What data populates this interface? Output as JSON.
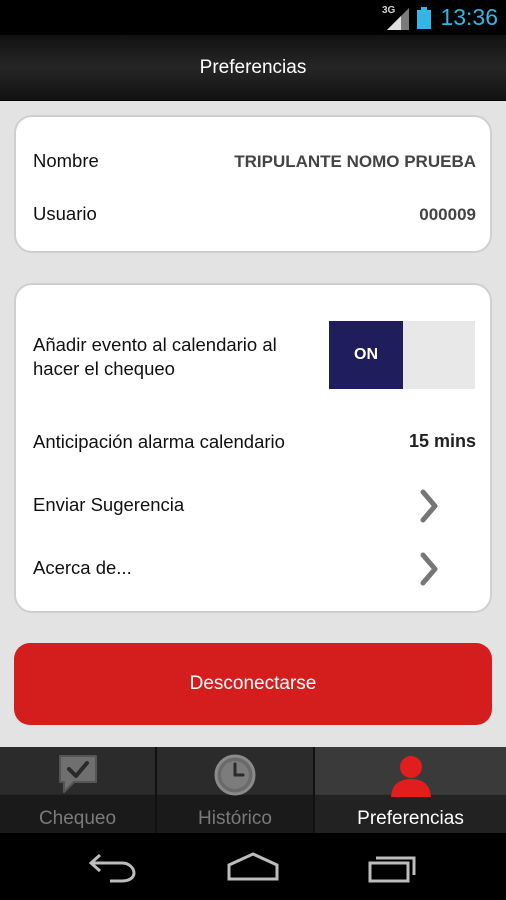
{
  "status_bar": {
    "network": "3G",
    "time": "13:36",
    "accent_color": "#33b5e5"
  },
  "action_bar": {
    "title": "Preferencias"
  },
  "user_card": {
    "nombre_label": "Nombre",
    "nombre_value": "TRIPULANTE NOMO PRUEBA",
    "usuario_label": "Usuario",
    "usuario_value": "000009"
  },
  "settings": {
    "calendar_label": "Añadir evento al calendario al hacer el chequeo",
    "calendar_toggle": "ON",
    "alarm_label": "Anticipación alarma calendario",
    "alarm_value": "15 mins",
    "suggestion_label": "Enviar Sugerencia",
    "about_label": "Acerca de..."
  },
  "logout": {
    "label": "Desconectarse",
    "color": "#d41e1e"
  },
  "tabs": [
    {
      "label": "Chequeo",
      "icon": "chat-check-icon",
      "selected": false
    },
    {
      "label": "Histórico",
      "icon": "clock-icon",
      "selected": false
    },
    {
      "label": "Preferencias",
      "icon": "user-icon",
      "selected": true
    }
  ],
  "system_nav": {
    "icons": [
      "back-icon",
      "home-icon",
      "recent-apps-icon"
    ]
  }
}
